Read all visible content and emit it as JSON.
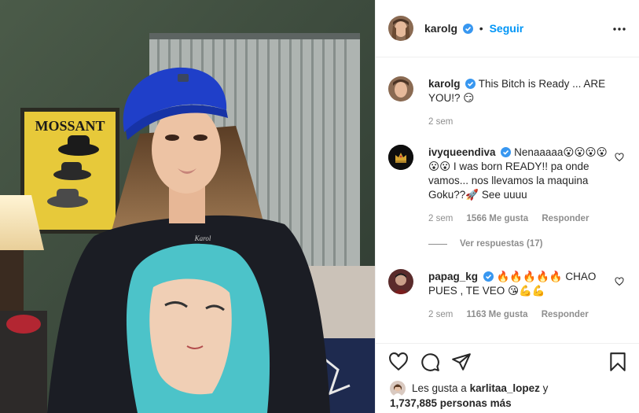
{
  "photo": {
    "poster_text": "MOSSANT",
    "shirt_text": "Karol"
  },
  "header": {
    "username": "karolg",
    "separator": "•",
    "follow_label": "Seguir"
  },
  "caption": {
    "username": "karolg",
    "text": "This Bitch is Ready ... ARE YOU!? 😏",
    "time": "2 sem"
  },
  "comments": [
    {
      "username": "ivyqueendiva",
      "text": "Nenaaaaa😮😮😮😮😮😮 I was born READY!! pa onde vamos... nos llevamos la maquina Goku??🚀 See uuuu",
      "time": "2 sem",
      "likes": "1566 Me gusta",
      "reply": "Responder"
    },
    {
      "username": "papag_kg",
      "text": "🔥🔥🔥🔥🔥 CHAO PUES , TE VEO 😘💪💪",
      "time": "2 sem",
      "likes": "1163 Me gusta",
      "reply": "Responder"
    }
  ],
  "view_replies": "Ver respuestas (17)",
  "likes": {
    "prefix": "Les gusta a",
    "user": "karlitaa_lopez",
    "conj": "y",
    "others": "1,737,885 personas más"
  },
  "colors": {
    "accent": "#0095f6",
    "verified": "#3897f0",
    "muted": "#8e8e8e",
    "text": "#262626"
  },
  "icons": [
    "verified-badge-icon",
    "more-options-icon",
    "heart-icon",
    "comment-icon",
    "share-icon",
    "bookmark-icon"
  ]
}
